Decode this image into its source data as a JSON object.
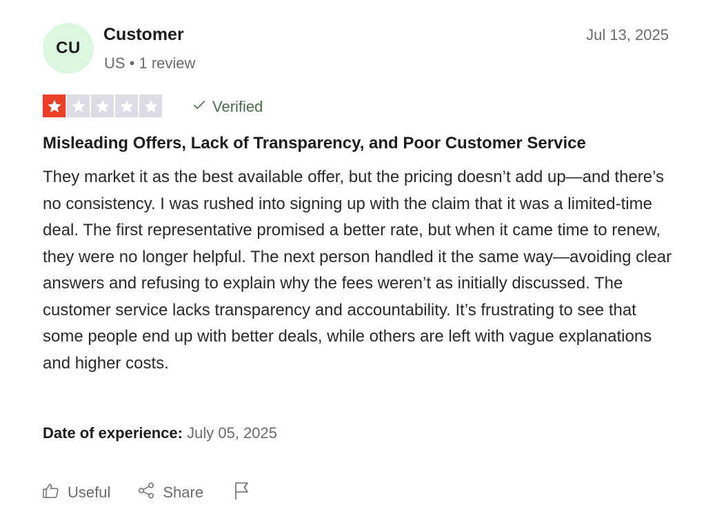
{
  "reviewer": {
    "initials": "CU",
    "name": "Customer",
    "meta": "US • 1 review"
  },
  "review": {
    "date": "Jul 13, 2025",
    "rating": 1,
    "max_rating": 5,
    "verified_label": "Verified",
    "title": "Misleading Offers, Lack of Transparency, and Poor Customer Service",
    "body": "They market it as the best available offer, but the pricing doesn’t add up—and there’s no consistency. I was rushed into signing up with the claim that it was a limited-time deal. The first representative promised a better rate, but when it came time to renew, they were no longer helpful. The next person handled it the same way—avoiding clear answers and refusing to explain why the fees weren’t as initially discussed. The customer service lacks transparency and accountability. It’s frustrating to see that some people end up with better deals, while others are left with vague explanations and higher costs.",
    "experience_label": "Date of experience:",
    "experience_date": "July 05, 2025"
  },
  "actions": {
    "useful_label": "Useful",
    "share_label": "Share"
  },
  "icons": {
    "useful": "thumbs-up-icon",
    "share": "share-icon",
    "report": "flag-icon",
    "verified": "check-icon",
    "star": "star-icon"
  },
  "colors": {
    "star_filled": "#ee3d26",
    "star_empty": "#dcdce6",
    "avatar_bg": "#dcf7e0",
    "verified_text": "#4b6b4e"
  }
}
